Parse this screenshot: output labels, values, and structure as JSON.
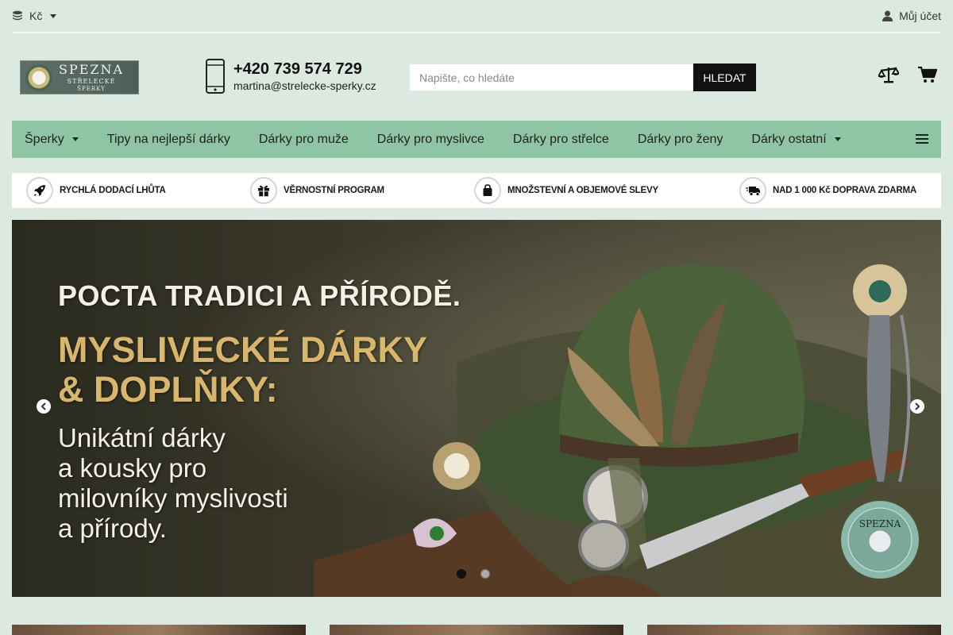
{
  "topbar": {
    "currency_label": "Kč",
    "currency_icon": "coins-icon",
    "account_label": "Můj účet",
    "account_icon": "user-icon"
  },
  "header": {
    "logo": {
      "line1": "SPEZNA",
      "line2": "STŘELECKÉ",
      "line3": "ŠPERKY"
    },
    "phone": "+420 739 574 729",
    "email": "martina@strelecke-sperky.cz",
    "search_placeholder": "Napište, co hledáte",
    "search_button": "HLEDAT",
    "compare_icon": "scale-icon",
    "cart_icon": "cart-icon"
  },
  "nav": {
    "items": [
      {
        "label": "Šperky",
        "dropdown": true
      },
      {
        "label": "Tipy na nejlepší dárky",
        "dropdown": false
      },
      {
        "label": "Dárky pro muže",
        "dropdown": false
      },
      {
        "label": "Dárky pro myslivce",
        "dropdown": false
      },
      {
        "label": "Dárky pro střelce",
        "dropdown": false
      },
      {
        "label": "Dárky pro ženy",
        "dropdown": false
      },
      {
        "label": "Dárky ostatní",
        "dropdown": true
      }
    ]
  },
  "benefits": [
    {
      "label": "RYCHLÁ DODACÍ LHŮTA",
      "icon": "rocket-icon"
    },
    {
      "label": "VĚRNOSTNÍ PROGRAM",
      "icon": "gift-icon"
    },
    {
      "label": "MNOŽSTEVNÍ A OBJEMOVÉ SLEVY",
      "icon": "shopping-bag-icon"
    },
    {
      "label": "NAD 1 000 Kč DOPRAVA ZDARMA",
      "icon": "delivery-truck-icon"
    }
  ],
  "hero": {
    "line1": "POCTA TRADICI A PŘÍRODĚ.",
    "line2": "MYSLIVECKÉ DÁRKY",
    "line3": "& DOPLŇKY:",
    "sub1": "Unikátní dárky",
    "sub2": "a kousky pro",
    "sub3": "milovníky myslivosti",
    "sub4": "a přírody.",
    "badge_text": "SPEZNA",
    "slides_total": 2,
    "active_slide": 1
  },
  "colors": {
    "background": "#dbe9e1",
    "nav": "#8fc4a4",
    "search_button": "#111111",
    "hero_gold": "#d8b76c"
  }
}
